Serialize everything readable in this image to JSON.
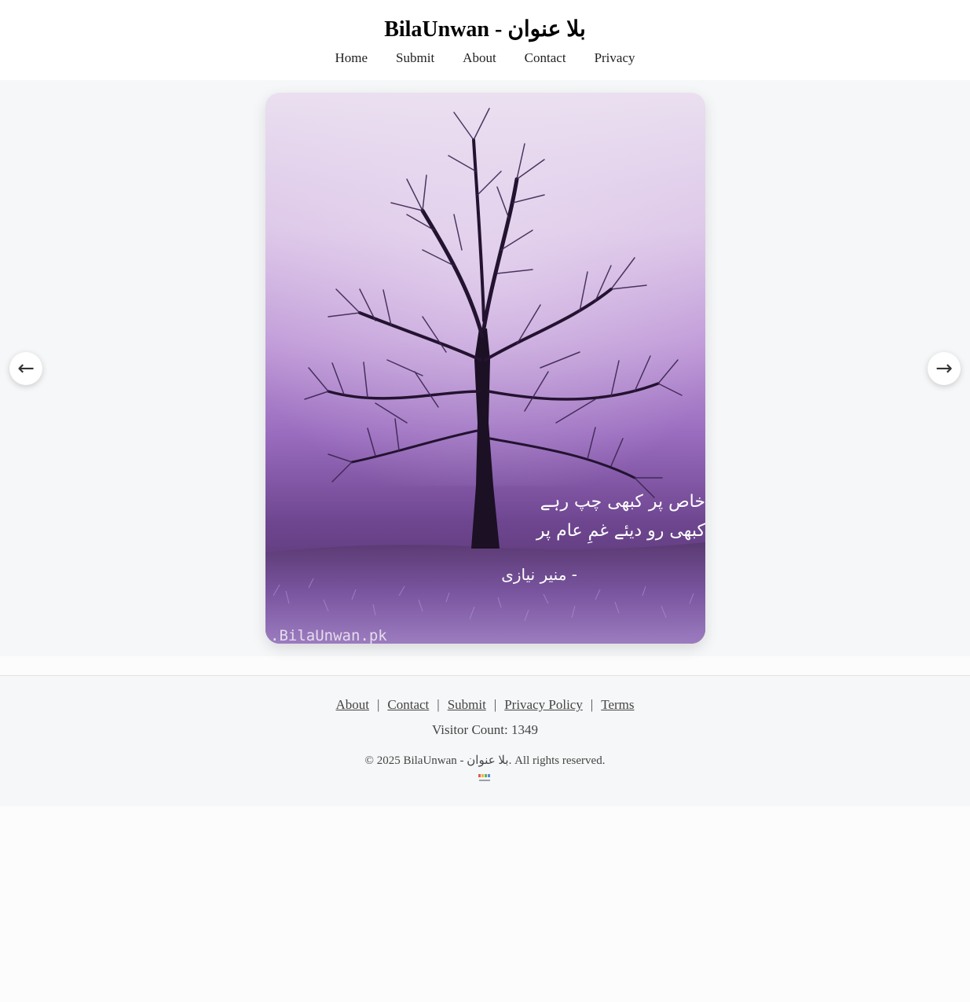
{
  "header": {
    "site_title": "BilaUnwan - بلا عنوان",
    "nav": [
      {
        "label": "Home"
      },
      {
        "label": "Submit"
      },
      {
        "label": "About"
      },
      {
        "label": "Contact"
      },
      {
        "label": "Privacy"
      }
    ]
  },
  "slider": {
    "prev_icon": "←",
    "next_icon": "→",
    "slide": {
      "poem_line_1": "خاص پر کبھی چپ رہے",
      "poem_line_2": "کبھی رو دیئے غمِ عام پر",
      "poet": "- منیر نیازی",
      "watermark": ".BilaUnwan.pk"
    }
  },
  "footer": {
    "links": [
      {
        "label": "About"
      },
      {
        "label": "Contact"
      },
      {
        "label": "Submit"
      },
      {
        "label": "Privacy Policy"
      },
      {
        "label": "Terms"
      }
    ],
    "separator": "|",
    "visitor_count": "Visitor Count: 1349",
    "copyright": "© 2025 BilaUnwan - بلا عنوان. All rights reserved."
  },
  "colors": {
    "page_bg": "#fcfcfc",
    "band_bg": "#f6f7f8",
    "image_top": "#e9dcef",
    "image_mid": "#a77bc7",
    "image_bottom": "#4d2e63"
  }
}
